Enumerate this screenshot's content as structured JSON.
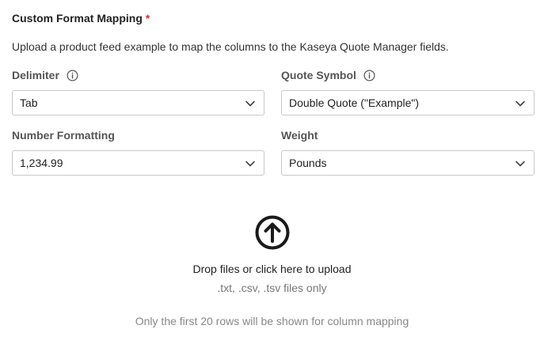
{
  "section": {
    "title": "Custom Format Mapping",
    "required_marker": "*",
    "description": "Upload a product feed example to map the columns to the Kaseya Quote Manager fields."
  },
  "fields": {
    "delimiter": {
      "label": "Delimiter",
      "value": "Tab",
      "has_info": true
    },
    "quote_symbol": {
      "label": "Quote Symbol",
      "value": "Double Quote (\"Example\")",
      "has_info": true
    },
    "number_formatting": {
      "label": "Number Formatting",
      "value": "1,234.99"
    },
    "weight": {
      "label": "Weight",
      "value": "Pounds"
    }
  },
  "upload": {
    "icon": "arrow-up-circle-icon",
    "prompt": "Drop files or click here to upload",
    "hint": ".txt, .csv, .tsv files only",
    "note": "Only the first 20 rows will be shown for column mapping"
  },
  "colors": {
    "required": "#d32f2f",
    "border": "#c9c9c9",
    "label": "#555555",
    "muted": "#888888"
  }
}
